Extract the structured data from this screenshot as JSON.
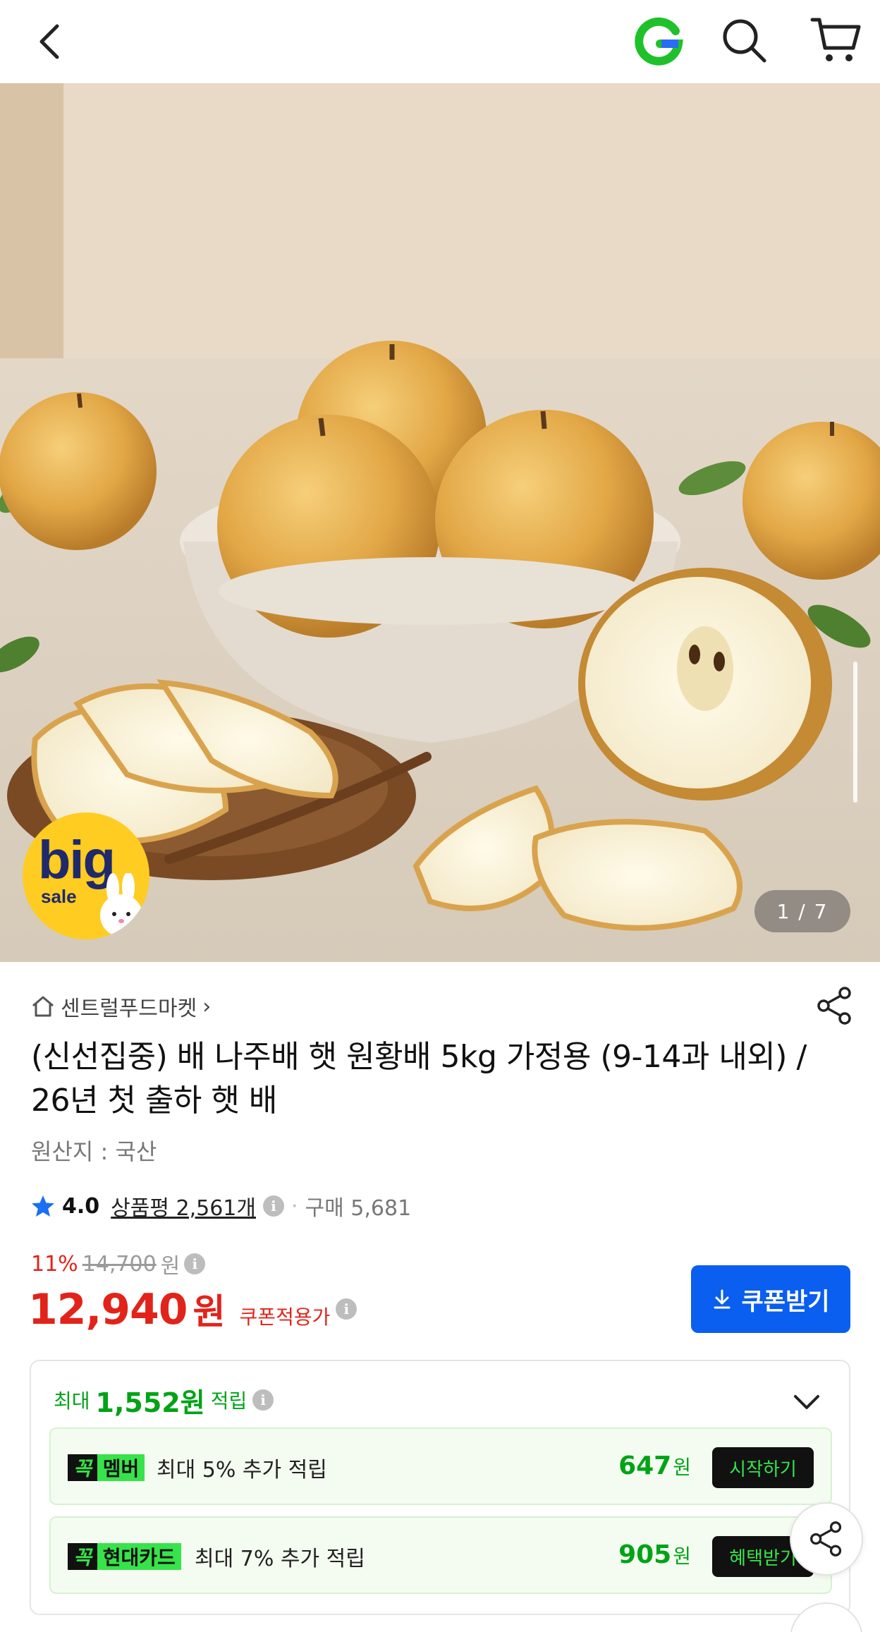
{
  "header": {
    "back_icon": "chevron-left-icon",
    "logo_icon": "g-logo-icon",
    "search_icon": "search-icon",
    "cart_icon": "cart-icon"
  },
  "gallery": {
    "counter": "1 / 7",
    "badge_big": "big",
    "badge_sale": "sale"
  },
  "product": {
    "seller": "센트럴푸드마켓",
    "seller_chevron": "›",
    "title": "(신선집중) 배 나주배 햇 원황배 5kg 가정용 (9-14과 내외) / 26년 첫 출하 햇 배",
    "origin": "원산지 : 국산",
    "rating": "4.0",
    "reviews_label": "상품평 2,561개",
    "dot": "·",
    "purchase_count": "구매 5,681"
  },
  "price": {
    "discount": "11%",
    "original": "14,700",
    "original_unit": "원",
    "final": "12,940",
    "final_unit": "원",
    "coupon_label": "쿠폰적용가",
    "coupon_button": "쿠폰받기"
  },
  "rewards": {
    "max_label": "최대",
    "max_amount": "1,552원",
    "accumulate_label": "적립",
    "rows": [
      {
        "tag_k": "꼭",
        "tag_text": "멤버",
        "desc": "최대 5% 추가 적립",
        "value": "647",
        "unit": "원",
        "action": "시작하기"
      },
      {
        "tag_k": "꼭",
        "tag_text": "현대카드",
        "desc": "최대 7% 추가 적립",
        "value": "905",
        "unit": "원",
        "action": "혜택받기"
      }
    ]
  },
  "colors": {
    "accent_red": "#e2231a",
    "accent_blue": "#0a5ef0",
    "accent_green": "#00a316",
    "logo_green": "#1fc12a"
  },
  "info_glyph": "i"
}
